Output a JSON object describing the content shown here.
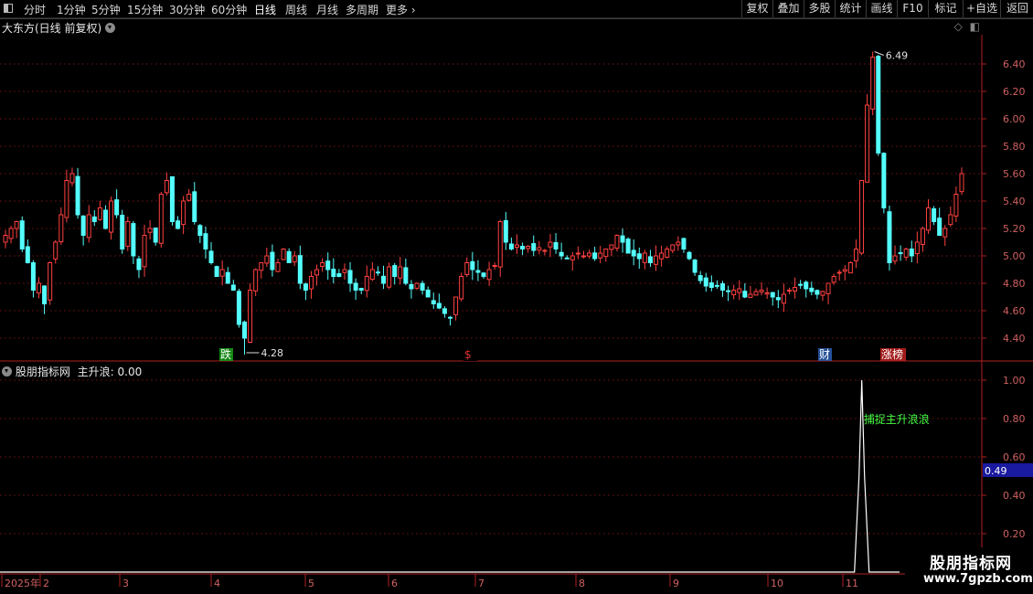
{
  "toolbar": {
    "periods": [
      "分时",
      "1分钟",
      "5分钟",
      "15分钟",
      "30分钟",
      "60分钟",
      "日线",
      "周线",
      "月线",
      "多周期",
      "更多"
    ],
    "active_period": "日线",
    "tools": [
      "复权",
      "叠加",
      "多股",
      "统计",
      "画线",
      "F10",
      "标记",
      "+自选",
      "返回"
    ]
  },
  "main_panel": {
    "title": "大东方(日线 前复权)",
    "high_label": "6.49",
    "low_label": "4.28",
    "markers": [
      {
        "text": "跌",
        "color": "#18a018"
      },
      {
        "text": "$",
        "color": "#e03030"
      },
      {
        "text": "财",
        "color": "#2a5db0"
      },
      {
        "text": "涨榜",
        "color": "#c02020"
      }
    ],
    "y_ticks": [
      "6.40",
      "6.20",
      "6.00",
      "5.80",
      "5.60",
      "5.40",
      "5.20",
      "5.00",
      "4.80",
      "4.60",
      "4.40"
    ]
  },
  "indicator_panel": {
    "title": "股朋指标网",
    "series_label": "主升浪:",
    "series_value": "0.00",
    "annotation": "捕捉主升浪浪",
    "current_value_box": "0.49",
    "y_ticks": [
      "1.00",
      "0.80",
      "0.60",
      "0.40",
      "0.20"
    ]
  },
  "time_axis": {
    "labels": [
      "2025年",
      "2",
      "3",
      "4",
      "5",
      "6",
      "7",
      "8",
      "9",
      "10",
      "11"
    ]
  },
  "logo": {
    "line1": "股朋指标网",
    "line2": "www.7gpzb.com"
  },
  "chart_data": {
    "type": "candlestick",
    "title": "大东方(日线 前复权)",
    "y_range": [
      4.3,
      6.5
    ],
    "marked_high": 6.49,
    "marked_low": 4.28,
    "closes": [
      5.15,
      5.2,
      5.25,
      5.05,
      4.95,
      4.75,
      4.8,
      4.65,
      4.95,
      5.1,
      5.3,
      5.55,
      5.6,
      5.3,
      5.15,
      5.3,
      5.25,
      5.35,
      5.2,
      5.4,
      5.3,
      5.05,
      5.25,
      5.0,
      4.9,
      5.15,
      5.2,
      5.1,
      5.45,
      5.55,
      5.25,
      5.2,
      5.4,
      5.45,
      5.25,
      5.15,
      5.05,
      4.95,
      4.85,
      4.9,
      4.8,
      4.75,
      4.5,
      4.4,
      4.75,
      4.9,
      4.95,
      5.0,
      4.9,
      4.95,
      5.05,
      4.95,
      5.0,
      4.8,
      4.75,
      4.85,
      4.9,
      4.95,
      4.9,
      4.85,
      4.85,
      4.9,
      4.8,
      4.75,
      4.75,
      4.85,
      4.9,
      4.88,
      4.8,
      4.92,
      4.85,
      4.92,
      4.8,
      4.76,
      4.8,
      4.75,
      4.7,
      4.65,
      4.62,
      4.58,
      4.55,
      4.7,
      4.85,
      4.95,
      4.9,
      4.88,
      4.85,
      4.9,
      4.93,
      5.25,
      5.1,
      5.05,
      5.08,
      5.05,
      5.07,
      5.04,
      5.06,
      5.04,
      5.1,
      5.05,
      5.0,
      4.98,
      5.0,
      5.02,
      5.0,
      5.02,
      4.98,
      5.02,
      5.05,
      5.08,
      5.15,
      5.1,
      5.02,
      5.0,
      4.98,
      5.02,
      4.95,
      5.0,
      5.02,
      5.05,
      5.08,
      5.1,
      5.05,
      4.98,
      4.88,
      4.82,
      4.78,
      4.77,
      4.78,
      4.75,
      4.74,
      4.75,
      4.76,
      4.7,
      4.72,
      4.74,
      4.75,
      4.73,
      4.7,
      4.68,
      4.72,
      4.75,
      4.77,
      4.79,
      4.76,
      4.74,
      4.72,
      4.74,
      4.8,
      4.85,
      4.88,
      4.9,
      4.95,
      5.05,
      5.55,
      6.1,
      6.45,
      5.75,
      5.35,
      4.95,
      5.0,
      5.02,
      5.05,
      5.0,
      5.1,
      5.2,
      5.35,
      5.25,
      5.15,
      5.2,
      5.3,
      5.45,
      5.6
    ]
  }
}
